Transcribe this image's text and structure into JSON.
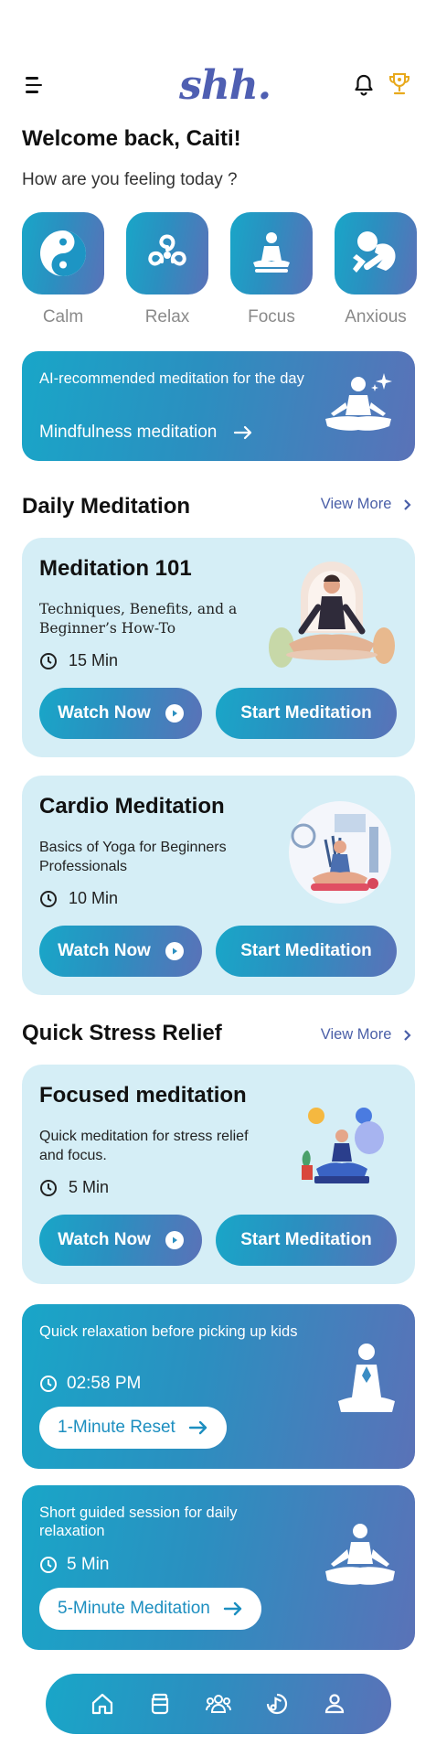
{
  "header": {
    "logo": "shh."
  },
  "greeting": {
    "welcome": "Welcome back, Caiti!",
    "question": "How are you feeling today ?"
  },
  "moods": [
    {
      "label": "Calm",
      "icon": "yin-yang-icon"
    },
    {
      "label": "Relax",
      "icon": "spiral-icon"
    },
    {
      "label": "Focus",
      "icon": "meditating-person-icon"
    },
    {
      "label": "Anxious",
      "icon": "anxious-person-icon"
    }
  ],
  "ai_card": {
    "caption": "AI-recommended meditation for the day",
    "title": "Mindfulness meditation"
  },
  "daily": {
    "title": "Daily Meditation",
    "view_more": "View More",
    "cards": [
      {
        "title": "Meditation 101",
        "desc": "Techniques, Benefits, and a Beginner’s How-To",
        "duration": "15 Min",
        "watch": "Watch Now",
        "start": "Start Meditation"
      },
      {
        "title": "Cardio Meditation",
        "desc": "Basics of Yoga for Beginners Professionals",
        "duration": "10 Min",
        "watch": "Watch Now",
        "start": "Start Meditation"
      }
    ]
  },
  "stress": {
    "title": "Quick Stress Relief",
    "view_more": "View More",
    "card": {
      "title": "Focused meditation",
      "desc": "Quick meditation for stress relief and focus.",
      "duration": "5 Min",
      "watch": "Watch Now",
      "start": "Start Meditation"
    }
  },
  "quick": [
    {
      "caption": "Quick relaxation before picking up kids",
      "time": "02:58 PM",
      "button": "1-Minute Reset"
    },
    {
      "caption": "Short guided session for daily relaxation",
      "time": "5 Min",
      "button": "5-Minute Meditation"
    }
  ],
  "nav": [
    "home-icon",
    "jar-icon",
    "community-icon",
    "music-icon",
    "profile-icon"
  ],
  "colors": {
    "accent": "#19a6c8",
    "accent_end": "#5a72b8",
    "card_light": "#d5eef6",
    "link": "#4a5fa8"
  }
}
